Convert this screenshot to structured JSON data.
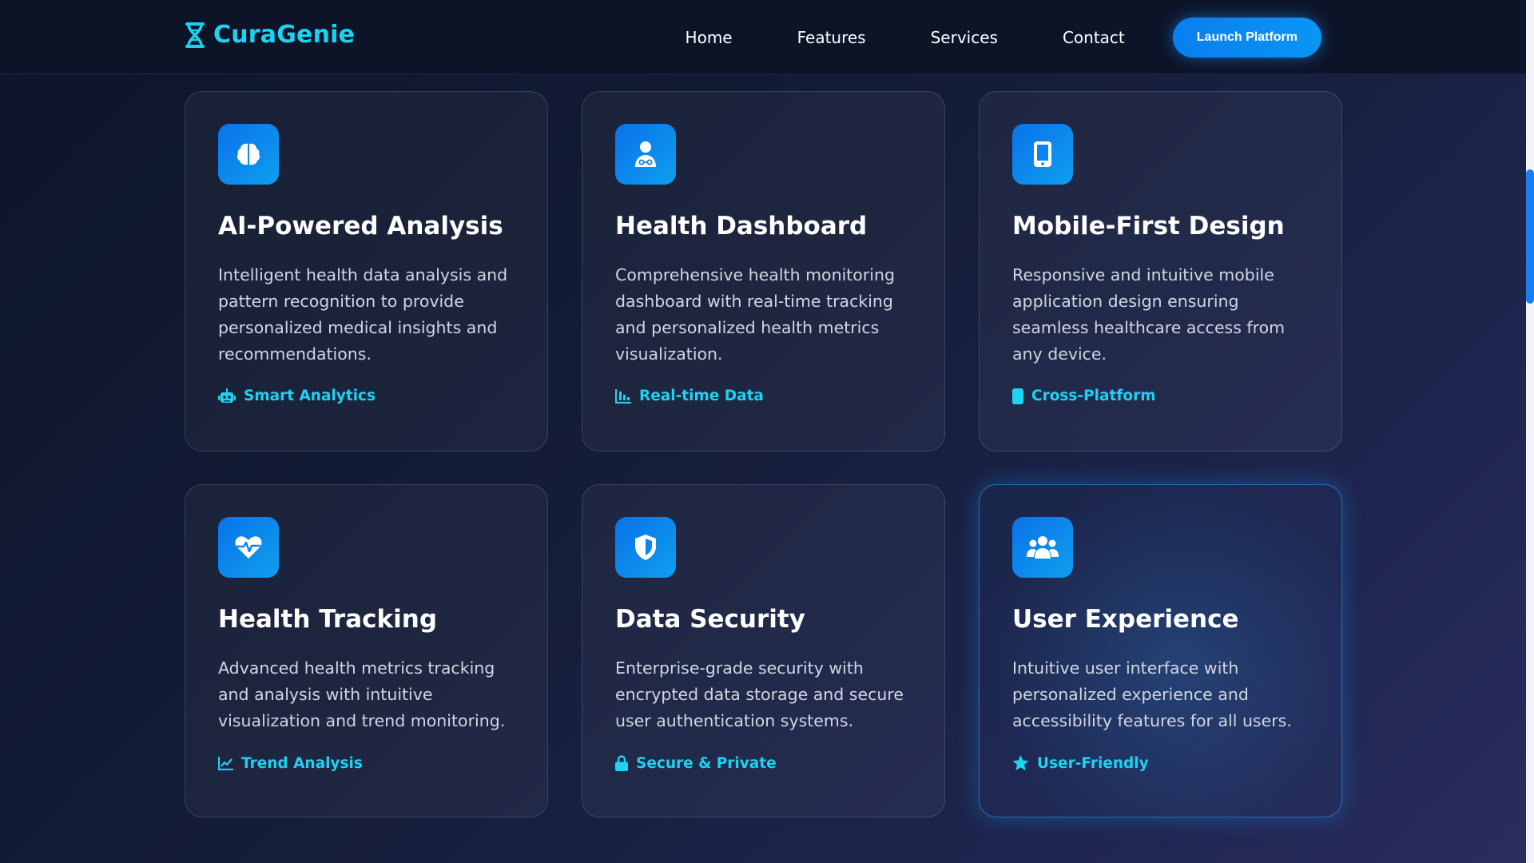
{
  "brand": {
    "name": "CuraGenie",
    "icon": "dna-icon",
    "color": "#19d3f0"
  },
  "nav": {
    "links": [
      "Home",
      "Features",
      "Services",
      "Contact"
    ],
    "cta": "Launch Platform"
  },
  "colors": {
    "accent": "#19d3f0",
    "button": "#0a85f0",
    "background": "#141d38",
    "icon_tile": "#0a85f0"
  },
  "features": [
    {
      "icon": "brain-icon",
      "title": "AI-Powered Analysis",
      "description": "Intelligent health data analysis and pattern recognition to provide personalized medical insights and recommendations.",
      "tag_icon": "robot-icon",
      "tag": "Smart Analytics"
    },
    {
      "icon": "doctor-icon",
      "title": "Health Dashboard",
      "description": "Comprehensive health monitoring dashboard with real-time tracking and personalized health metrics visualization.",
      "tag_icon": "bar-chart-icon",
      "tag": "Real-time Data"
    },
    {
      "icon": "mobile-icon",
      "title": "Mobile-First Design",
      "description": "Responsive and intuitive mobile application design ensuring seamless healthcare access from any device.",
      "tag_icon": "mobile-icon",
      "tag": "Cross-Platform"
    },
    {
      "icon": "heart-pulse-icon",
      "title": "Health Tracking",
      "description": "Advanced health metrics tracking and analysis with intuitive visualization and trend monitoring.",
      "tag_icon": "line-chart-icon",
      "tag": "Trend Analysis"
    },
    {
      "icon": "shield-icon",
      "title": "Data Security",
      "description": "Enterprise-grade security with encrypted data storage and secure user authentication systems.",
      "tag_icon": "lock-icon",
      "tag": "Secure & Private"
    },
    {
      "icon": "users-icon",
      "title": "User Experience",
      "description": "Intuitive user interface with personalized experience and accessibility features for all users.",
      "tag_icon": "star-icon",
      "tag": "User-Friendly"
    }
  ]
}
